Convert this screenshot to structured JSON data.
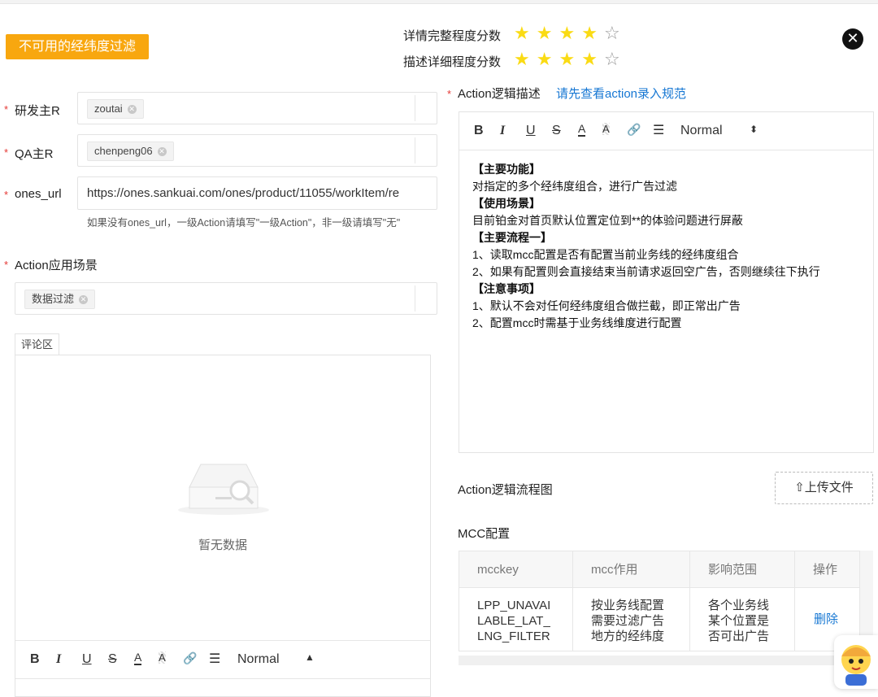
{
  "header": {
    "tag": "不可用的经纬度过滤",
    "scores": [
      {
        "label": "详情完整程度分数",
        "stars_filled": 4,
        "stars_total": 5
      },
      {
        "label": "描述详细程度分数",
        "stars_filled": 4,
        "stars_total": 5
      }
    ],
    "close_symbol": "✕"
  },
  "form": {
    "rd_owner": {
      "label": "研发主R",
      "value": "zoutai"
    },
    "qa_owner": {
      "label": "QA主R",
      "value": "chenpeng06"
    },
    "ones_url": {
      "label": "ones_url",
      "value": "https://ones.sankuai.com/ones/product/11055/workItem/re",
      "hint": "如果没有ones_url，一级Action请填写\"一级Action\"，非一级请填写\"无\""
    },
    "scene": {
      "label": "Action应用场景",
      "value": "数据过滤"
    }
  },
  "comments": {
    "tab": "评论区",
    "empty_text": "暂无数据",
    "toolbar": {
      "b": "B",
      "i": "I",
      "u": "U",
      "s": "S",
      "color": "A",
      "bg": "A",
      "link": "🔗",
      "list": "☰",
      "style": "Normal"
    }
  },
  "action_desc": {
    "label": "Action逻辑描述",
    "link": "请先查看action录入规范",
    "toolbar": {
      "b": "B",
      "i": "I",
      "u": "U",
      "s": "S",
      "color": "A",
      "bg": "A",
      "link": "🔗",
      "list": "☰",
      "style": "Normal"
    },
    "lines": [
      {
        "text": "【主要功能】",
        "bold": true
      },
      {
        "text": "对指定的多个经纬度组合，进行广告过滤",
        "bold": false
      },
      {
        "text": "【使用场景】",
        "bold": true
      },
      {
        "text": "目前铂金对首页默认位置定位到**的体验问题进行屏蔽",
        "bold": false
      },
      {
        "text": "【主要流程一】",
        "bold": true
      },
      {
        "text": "1、读取mcc配置是否有配置当前业务线的经纬度组合",
        "bold": false
      },
      {
        "text": "2、如果有配置则会直接结束当前请求返回空广告，否则继续往下执行",
        "bold": false
      },
      {
        "text": "【注意事项】",
        "bold": true
      },
      {
        "text": "1、默认不会对任何经纬度组合做拦截，即正常出广告",
        "bold": false
      },
      {
        "text": "2、配置mcc时需基于业务线维度进行配置",
        "bold": false
      }
    ]
  },
  "flowchart": {
    "label": "Action逻辑流程图",
    "upload": "上传文件"
  },
  "mcc": {
    "label": "MCC配置",
    "columns": [
      "mcckey",
      "mcc作用",
      "影响范围",
      "操作"
    ],
    "row": {
      "key": [
        "LPP_UNAVAI",
        "LABLE_LAT_",
        "LNG_FILTER"
      ],
      "effect": [
        "按业务线配置",
        "需要过滤广告",
        "地方的经纬度"
      ],
      "scope": [
        "各个业务线",
        "某个位置是",
        "否可出广告"
      ],
      "action": "删除"
    }
  }
}
